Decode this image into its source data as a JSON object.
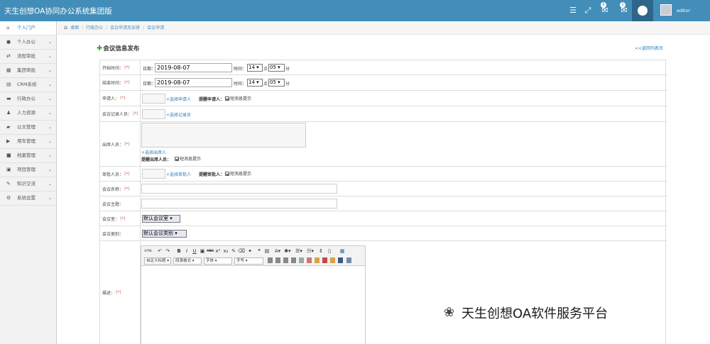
{
  "app": {
    "title": "天生创想OA协同办公系统集团版",
    "user": "editor"
  },
  "header": {
    "badges": [
      "6",
      "3"
    ]
  },
  "sidebar": {
    "items": [
      {
        "label": "个人门户",
        "icon": "home-icon",
        "active": true
      },
      {
        "label": "个人办公",
        "icon": "user-icon"
      },
      {
        "label": "流程审批",
        "icon": "flow-icon"
      },
      {
        "label": "集团审批",
        "icon": "group-icon"
      },
      {
        "label": "CRM系统",
        "icon": "crm-icon"
      },
      {
        "label": "行政办公",
        "icon": "briefcase-icon"
      },
      {
        "label": "人力资源",
        "icon": "people-icon"
      },
      {
        "label": "公文管理",
        "icon": "folder-icon"
      },
      {
        "label": "用车管理",
        "icon": "car-icon"
      },
      {
        "label": "档案管理",
        "icon": "archive-icon"
      },
      {
        "label": "项目管理",
        "icon": "project-icon"
      },
      {
        "label": "知识交流",
        "icon": "knowledge-icon"
      },
      {
        "label": "系统设置",
        "icon": "settings-icon"
      }
    ]
  },
  "breadcrumb": [
    "桌面",
    "行政办公",
    "会议申请及安排",
    "会议申请"
  ],
  "page": {
    "title": "会议信息发布",
    "back": "<<返回列表页"
  },
  "form": {
    "start_time": {
      "label": "开始时间：",
      "req": "(*)",
      "date_label": "日期：",
      "date": "2019-08-07",
      "time_label": "时间：",
      "hour": "14",
      "hour_unit": "点",
      "minute": "05",
      "minute_unit": "分"
    },
    "end_time": {
      "label": "结束时间：",
      "req": "(*)",
      "date_label": "日期：",
      "date": "2019-08-07",
      "time_label": "时间：",
      "hour": "14",
      "hour_unit": "点",
      "minute": "05",
      "minute_unit": "分"
    },
    "applicant": {
      "label": "申请人：",
      "req": "(*)",
      "link": "+选择申请人",
      "remind": "提醒申请人：",
      "sms": "短消息提示"
    },
    "recorder": {
      "label": "会议记录人员：",
      "req": "(*)",
      "link": "+选择记录员"
    },
    "attendees": {
      "label": "出席人员：",
      "req": "(*)",
      "link": "+选择出席人",
      "remind": "提醒出席人员：",
      "sms": "短消息提示"
    },
    "approver": {
      "label": "审批人员：",
      "req": "(*)",
      "link": "+选择审批人",
      "remind": "提醒审批人：",
      "sms": "短消息提示"
    },
    "name": {
      "label": "会议名称：",
      "req": "(*)"
    },
    "topic": {
      "label": "会议主题：",
      "req": ""
    },
    "room": {
      "label": "会议室：",
      "req": "(*)",
      "value": "默认会议室"
    },
    "type": {
      "label": "会议类别：",
      "req": "",
      "value": "默认会议类别"
    },
    "desc": {
      "label": "描述：",
      "req": "(*)"
    }
  },
  "editor": {
    "heading": "自定义标题",
    "para": "段落格式",
    "font": "字体",
    "size": "字号"
  },
  "watermark": "天生创想OA软件服务平台"
}
